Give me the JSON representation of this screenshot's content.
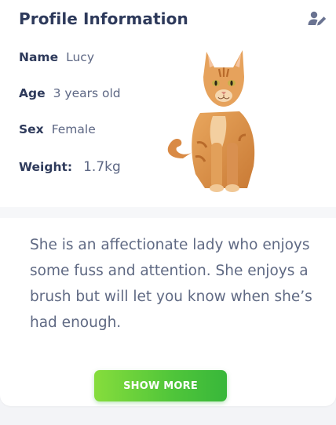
{
  "profile": {
    "title": "Profile Information",
    "edit_icon": "user-edit-icon",
    "fields": {
      "name_label": "Name",
      "name_value": "Lucy",
      "age_label": "Age",
      "age_value": "3 years old",
      "sex_label": "Sex",
      "sex_value": "Female",
      "weight_label": "Weight:",
      "weight_value": "1.7kg"
    },
    "photo": "orange-tabby-cat-photo"
  },
  "description": "She is an affectionate lady who enjoys some fuss and attention. She enjoys a brush but will let you know when she’s had enough.",
  "actions": {
    "show_more_label": "SHOW MORE"
  },
  "colors": {
    "title": "#2e3a5b",
    "value_text": "#5d6784",
    "button_start": "#86dd3c",
    "button_end": "#38b73a",
    "background": "#f3f4f7"
  }
}
